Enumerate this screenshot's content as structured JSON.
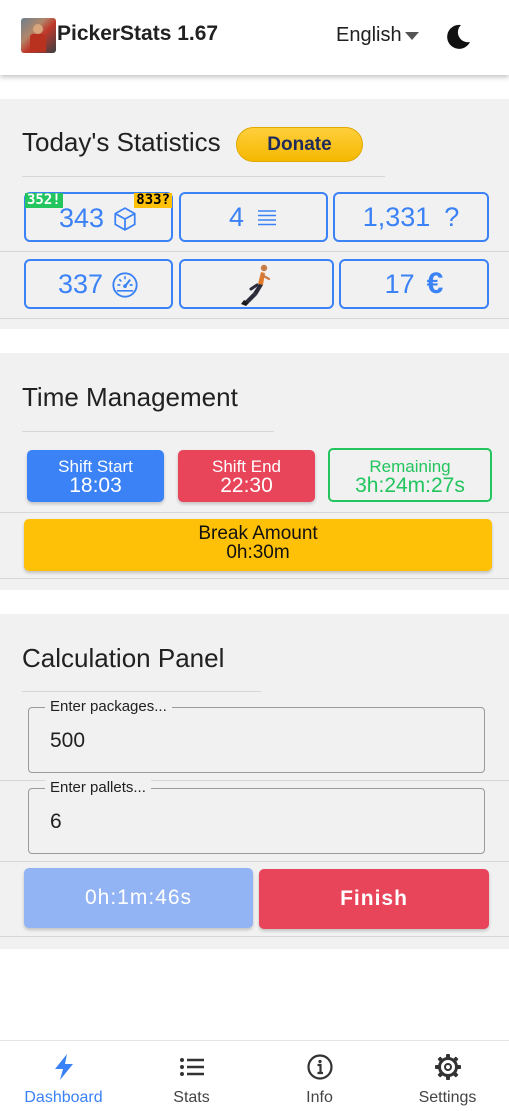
{
  "app": {
    "title": "PickerStats 1.67",
    "language": "English"
  },
  "stats": {
    "title": "Today's Statistics",
    "donate_label": "Donate",
    "packages": {
      "value": "343",
      "badge_left": "352!",
      "badge_right": "833?"
    },
    "pallets": {
      "value": "4"
    },
    "unknown": {
      "value": "1,331",
      "symbol": "?"
    },
    "speed": {
      "value": "337"
    },
    "earnings": {
      "value": "17",
      "currency": "€"
    }
  },
  "time": {
    "title": "Time Management",
    "shift_start": {
      "label": "Shift Start",
      "value": "18:03"
    },
    "shift_end": {
      "label": "Shift End",
      "value": "22:30"
    },
    "remaining": {
      "label": "Remaining",
      "value": "3h:24m:27s"
    },
    "break": {
      "label": "Break Amount",
      "value": "0h:30m"
    }
  },
  "calc": {
    "title": "Calculation Panel",
    "packages": {
      "label": "Enter packages...",
      "value": "500"
    },
    "pallets": {
      "label": "Enter pallets...",
      "value": "6"
    },
    "timer": "0h:1m:46s",
    "finish_label": "Finish"
  },
  "nav": {
    "items": [
      {
        "label": "Dashboard",
        "icon": "bolt-icon",
        "active": true
      },
      {
        "label": "Stats",
        "icon": "list-icon"
      },
      {
        "label": "Info",
        "icon": "info-icon"
      },
      {
        "label": "Settings",
        "icon": "gear-icon"
      }
    ]
  },
  "colors": {
    "primary": "#3b82f6",
    "danger": "#e8445a",
    "success": "#22c55e",
    "warning": "#ffc107",
    "timer_disabled": "#93b4f4"
  }
}
